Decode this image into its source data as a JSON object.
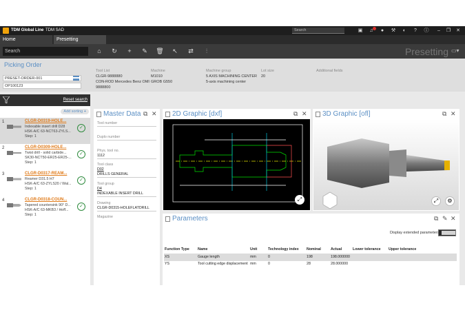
{
  "titlebar": {
    "brand": "TDM Global Line",
    "product": "TDM SAD",
    "search_placeholder": "Search",
    "notification_count": "1"
  },
  "tabs": [
    {
      "label": "Home"
    },
    {
      "label": "Presetting"
    }
  ],
  "toolbar": {
    "search_placeholder": "Search",
    "page_title": "Presetting"
  },
  "picking": {
    "title": "Picking Order",
    "order": "PRESET-ORDER-001",
    "operation": "OP100123"
  },
  "header_fields": [
    {
      "label": "Tool List",
      "values": [
        "CLGR-9888880",
        "CON-ROD Mercedes Benz OMI",
        "9888800"
      ]
    },
    {
      "label": "Machine",
      "values": [
        "M1010",
        "GROB G550"
      ]
    },
    {
      "label": "Machine group",
      "values": [
        "5 AXIS MACHINING CENTER",
        "5-axis machining center"
      ]
    },
    {
      "label": "Lot size",
      "values": [
        "20"
      ]
    },
    {
      "label": "Additional fields",
      "values": []
    }
  ],
  "left": {
    "reset_search": "Reset search",
    "add_sorting": "Add sorting",
    "items": [
      {
        "num": "1",
        "title": "CLGR-D0319-HOLE...",
        "line1": "Indexable insert drill D28",
        "line2": "HSK-A/C 63-NCT63-ZYLS...",
        "step": "Step: 1"
      },
      {
        "num": "2",
        "title": "CLGR-D0309-HOLE...",
        "line1": "Twist drill - solid carbide...",
        "line2": "SK30-NCT50-ER25-ER25-...",
        "step": "Step: 1"
      },
      {
        "num": "3",
        "title": "CLGR-D0317-REAM...",
        "line1": "Reamer D31.5 H7",
        "line2": "HSK-A/C 63-ZYLS20 / Wal...",
        "step": "Step: 1"
      },
      {
        "num": "4",
        "title": "CLGR-D0318-COUN...",
        "line1": "Tapered countersink 90° D...",
        "line2": "HSK-A/C 63-MKB3 / Hoff...",
        "step": "Step: 1"
      }
    ]
  },
  "master": {
    "title": "Master Data",
    "fields": [
      {
        "label": "Tool number",
        "value": ""
      },
      {
        "label": "Duplo number",
        "value": ""
      },
      {
        "label": "Phys. tool no.",
        "value": "1112"
      },
      {
        "label": "Tool class",
        "value": "D02",
        "value2": "DRILLS GENERAL"
      },
      {
        "label": "Tool group",
        "value": "D4",
        "value2": "INDEXABLE INSERT DRILL"
      },
      {
        "label": "Drawing",
        "value": "CLGR-D0315-HOLEFLATDRILL"
      },
      {
        "label": "Magazine",
        "value": ""
      }
    ]
  },
  "graphic2d": {
    "title": "2D Graphic [dxf]"
  },
  "graphic3d": {
    "title": "3D Graphic [ofl]"
  },
  "params": {
    "title": "Parameters",
    "ext_label": "Display extended parameters",
    "columns": [
      "Function Type",
      "Name",
      "Unit",
      "Technology index",
      "Nominal",
      "Actual",
      "Lower tolerance",
      "Upper tolerance"
    ],
    "rows": [
      [
        "XS",
        "Gauge length",
        "mm",
        "0",
        "198",
        "198.000000",
        "",
        ""
      ],
      [
        "YS",
        "Tool cutting edge displacement",
        "mm",
        "0",
        "28",
        "28.000000",
        "",
        ""
      ]
    ]
  },
  "colors": {
    "accent": "#5b8fc4",
    "title_orange": "#e07a18",
    "check_green": "#2e8b3d",
    "dark": "#2b2b2b"
  }
}
